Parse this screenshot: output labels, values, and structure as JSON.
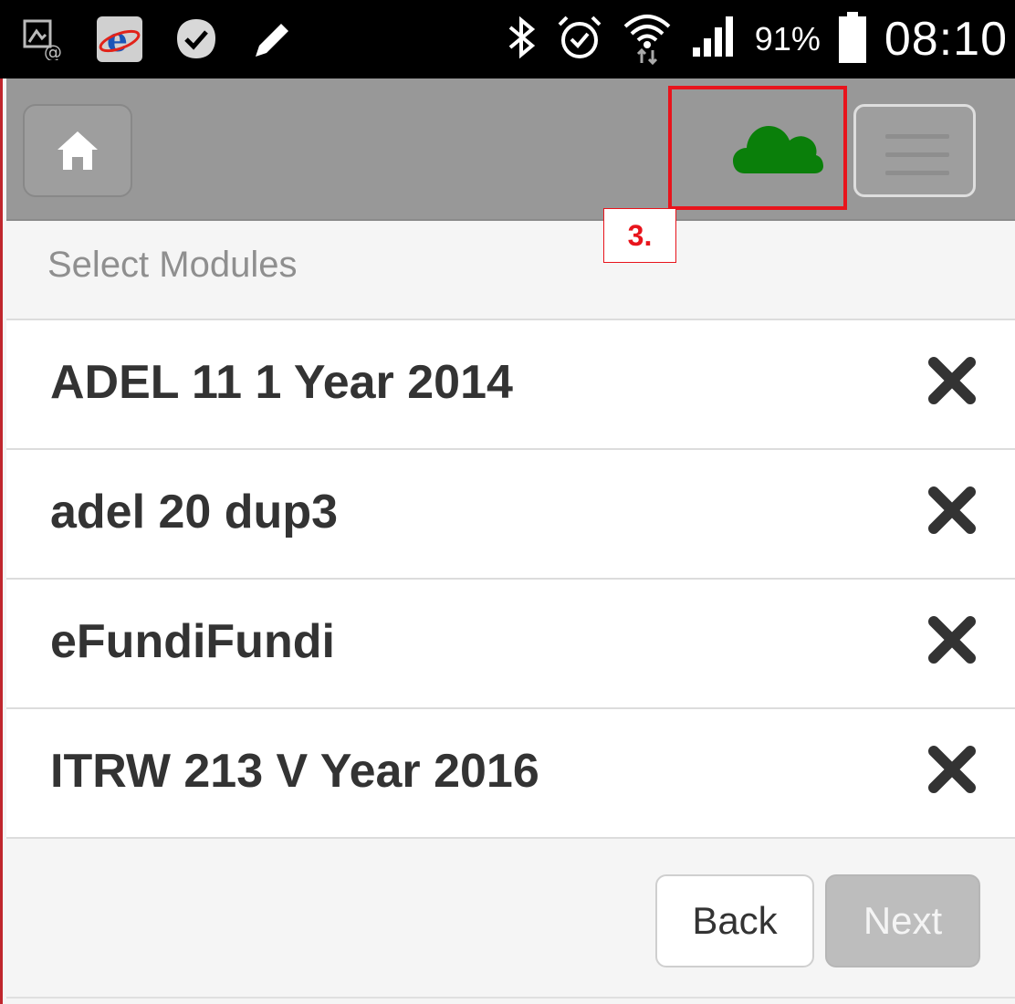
{
  "status_bar": {
    "left_icons": [
      "screenshot-icon",
      "ie-icon",
      "checkmark-icon",
      "pencil-icon"
    ],
    "right_icons": [
      "bluetooth-icon",
      "alarm-icon",
      "wifi-icon",
      "signal-icon",
      "battery-icon"
    ],
    "battery_percent": "91%",
    "time": "08:10"
  },
  "toolbar": {
    "home_icon": "home-icon",
    "sync_icon": "cloud-icon",
    "sync_color": "#0a7f0a",
    "menu_icon": "hamburger-menu-icon",
    "highlight_color": "#e8141c",
    "step_label": "3."
  },
  "page": {
    "title": "Select Modules"
  },
  "modules": [
    {
      "name": "ADEL 11 1 Year 2014"
    },
    {
      "name": "adel 20 dup3"
    },
    {
      "name": "eFundiFundi"
    },
    {
      "name": "ITRW 213 V Year 2016"
    }
  ],
  "footer": {
    "back_label": "Back",
    "next_label": "Next"
  }
}
